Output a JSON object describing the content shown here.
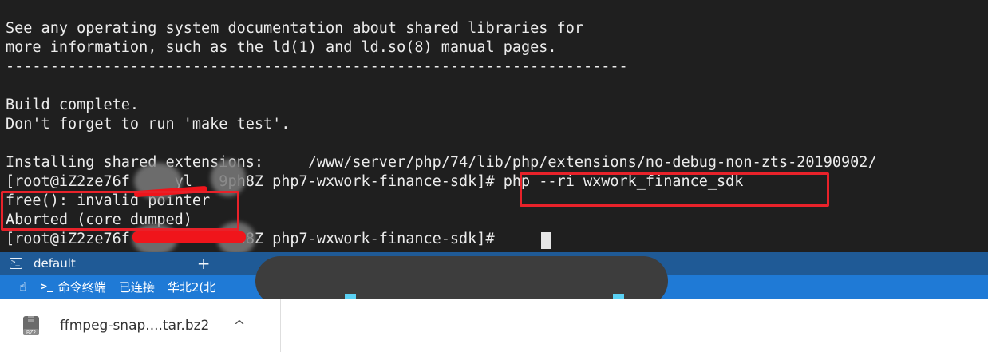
{
  "terminal": {
    "lines": [
      "See any operating system documentation about shared libraries for",
      "more information, such as the ld(1) and ld.so(8) manual pages.",
      "----------------------------------------------------------------------",
      "",
      "Build complete.",
      "Don't forget to run 'make test'.",
      "",
      "Installing shared extensions:     /www/server/php/74/lib/php/extensions/no-debug-non-zts-20190902/",
      "[root@iZ2ze76f     yl   9ph8Z php7-wxwork-finance-sdk]# php --ri wxwork_finance_sdk",
      "free(): invalid pointer",
      "Aborted (core dumped)",
      "[root@iZ2ze76f      l     h8Z php7-wxwork-finance-sdk]# "
    ]
  },
  "tabbar": {
    "tab_label": "default",
    "add_label": "+"
  },
  "statusbar": {
    "hand_icon": "☝",
    "term_icon": ">_",
    "terminal_label": "命令终端",
    "connection_status": "已连接",
    "region": "华北2(北"
  },
  "downloads": {
    "file_name": "ffmpeg-snap....tar.bz2",
    "file_icon_label": "BZ2",
    "chevron": "^"
  },
  "colors": {
    "terminal_bg": "#1f1f1f",
    "highlight_red": "#e8222a",
    "tabbar_bg": "#1f5a96",
    "statusbar_bg": "#1f7ad6"
  }
}
